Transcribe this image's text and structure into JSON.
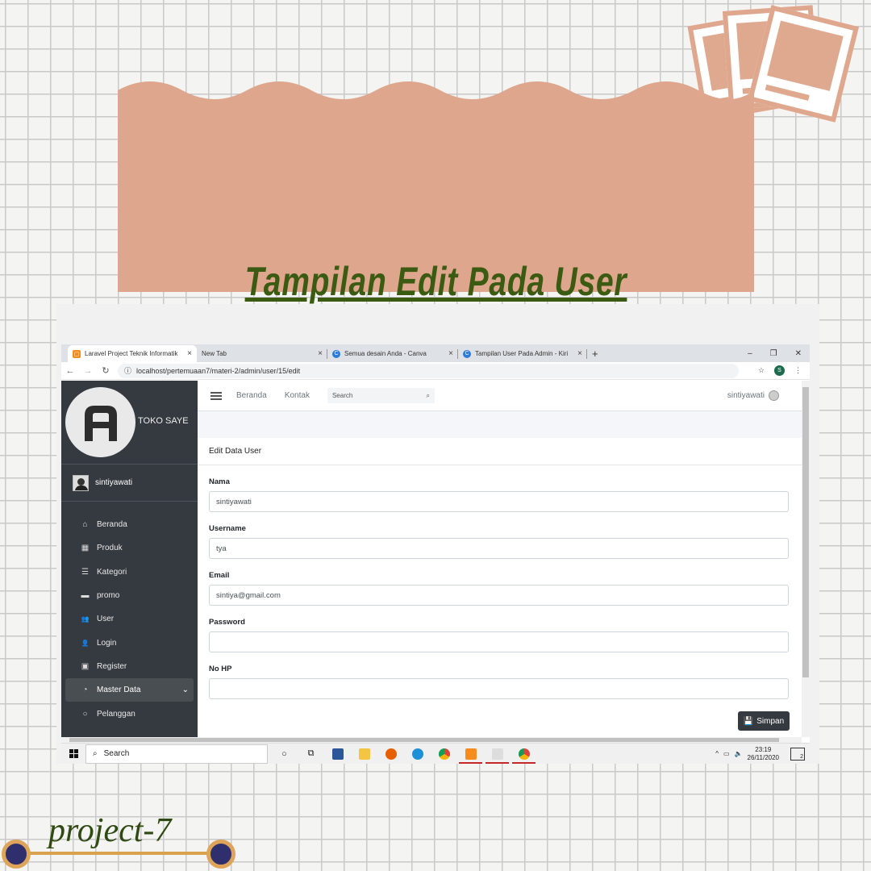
{
  "banner": {
    "title": " Tampilan  Edit Pada User"
  },
  "browser": {
    "tabs": [
      {
        "label": "Laravel Project Teknik Informatik",
        "icon": "xampp-icon",
        "active": true
      },
      {
        "label": "New Tab",
        "icon": "",
        "active": false
      },
      {
        "label": "Semua desain Anda - Canva",
        "icon": "canva-icon",
        "active": false
      },
      {
        "label": "Tampilan User Pada Admin - Kiri",
        "icon": "canva-icon",
        "active": false
      }
    ],
    "url": "localhost/pertemuaan7/materi-2/admin/user/15/edit",
    "profile_letter": "S"
  },
  "sidebar": {
    "brand": "TOKO SAYE",
    "user": "sintiyawati",
    "items": [
      {
        "label": "Beranda",
        "icon": "home-icon",
        "glyph": "⌂"
      },
      {
        "label": "Produk",
        "icon": "grid-icon",
        "glyph": "▦"
      },
      {
        "label": "Kategori",
        "icon": "list-icon",
        "glyph": "☰"
      },
      {
        "label": "promo",
        "icon": "wallet-icon",
        "glyph": "▬"
      },
      {
        "label": "User",
        "icon": "users-icon",
        "glyph": "👥"
      },
      {
        "label": "Login",
        "icon": "user-icon",
        "glyph": "👤"
      },
      {
        "label": "Register",
        "icon": "id-card-icon",
        "glyph": "▣"
      },
      {
        "label": "Master Data",
        "icon": "dashboard-icon",
        "glyph": "◔"
      },
      {
        "label": "Pelanggan",
        "icon": "circle-icon",
        "glyph": "○"
      }
    ]
  },
  "topnav": {
    "links": [
      "Beranda",
      "Kontak"
    ],
    "search_placeholder": "Search",
    "user": "sintiyawati"
  },
  "form": {
    "title": "Edit Data User",
    "fields": [
      {
        "label": "Nama",
        "value": "sintiyawati"
      },
      {
        "label": "Username",
        "value": "tya"
      },
      {
        "label": "Email",
        "value": "sintiya@gmail.com"
      },
      {
        "label": "Password",
        "value": ""
      },
      {
        "label": "No HP",
        "value": ""
      }
    ],
    "save_label": "Simpan"
  },
  "taskbar": {
    "search_label": "Search",
    "time": "23:19",
    "date": "26/11/2020",
    "notification_count": "2"
  },
  "footer": {
    "label": "project-7"
  },
  "colors": {
    "banner": "#dea68c",
    "sidebar": "#343a40",
    "title": "#3b5a12"
  }
}
